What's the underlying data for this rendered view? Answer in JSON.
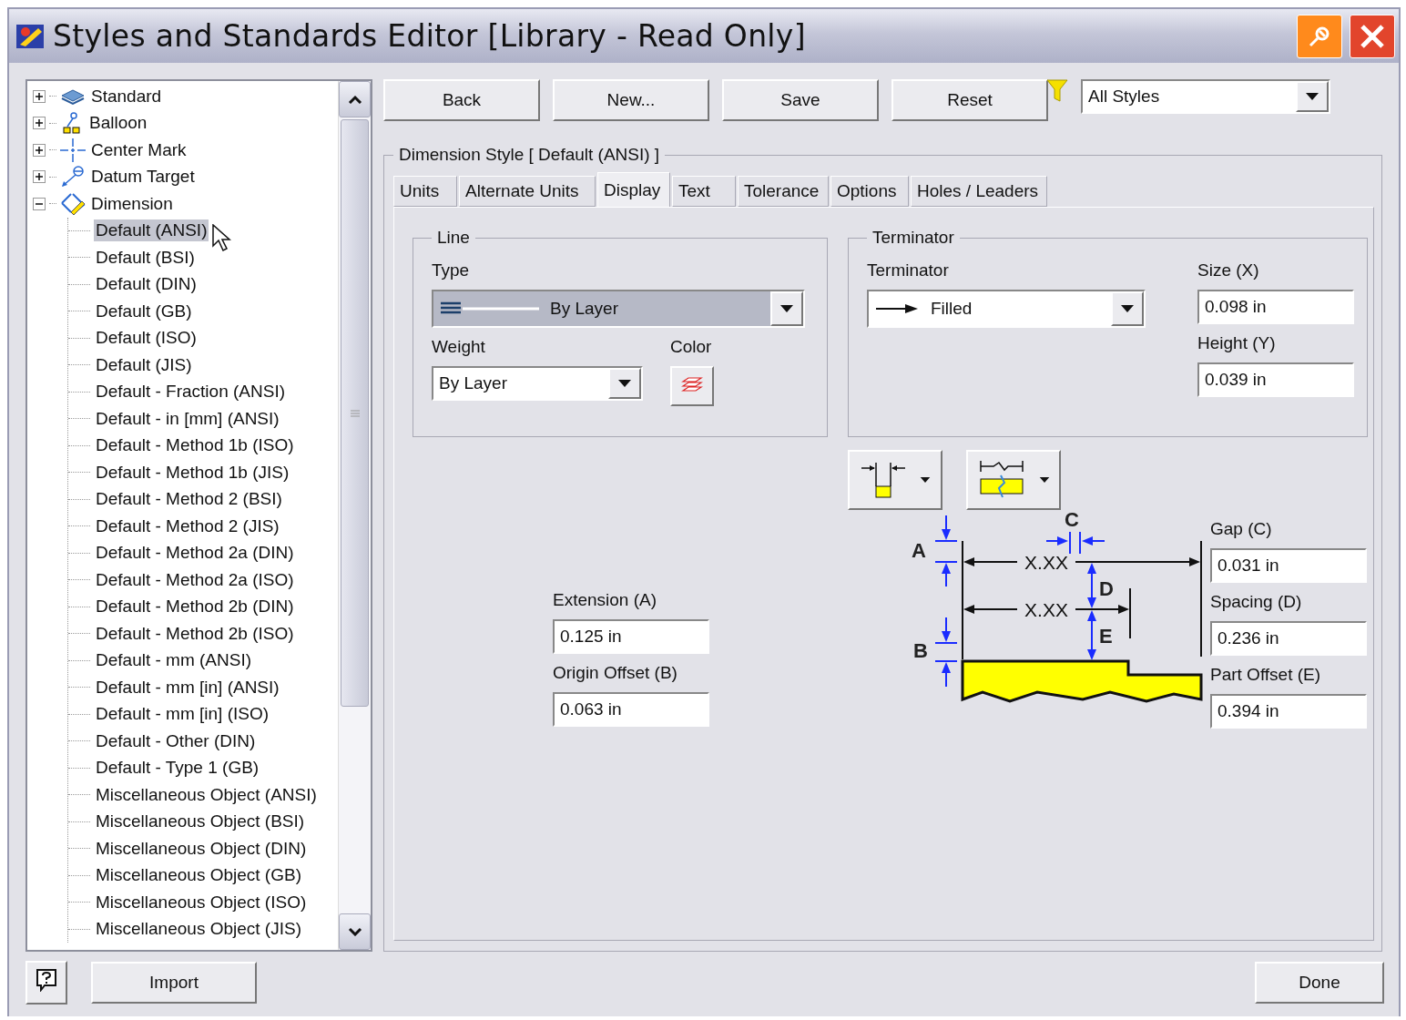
{
  "window": {
    "title": "Styles and Standards Editor [Library - Read Only]"
  },
  "tree": {
    "items": [
      {
        "label": "Standard",
        "expanded": false
      },
      {
        "label": "Balloon",
        "expanded": false
      },
      {
        "label": "Center Mark",
        "expanded": false
      },
      {
        "label": "Datum Target",
        "expanded": false
      },
      {
        "label": "Dimension",
        "expanded": true,
        "children": [
          {
            "label": "Default (ANSI)",
            "selected": true
          },
          {
            "label": "Default (BSI)",
            "selected": false
          },
          {
            "label": "Default (DIN)",
            "selected": false
          },
          {
            "label": "Default (GB)",
            "selected": false
          },
          {
            "label": "Default (ISO)",
            "selected": false
          },
          {
            "label": "Default (JIS)",
            "selected": false
          },
          {
            "label": "Default - Fraction (ANSI)",
            "selected": false
          },
          {
            "label": "Default - in [mm] (ANSI)",
            "selected": false
          },
          {
            "label": "Default - Method 1b (ISO)",
            "selected": false
          },
          {
            "label": "Default - Method 1b (JIS)",
            "selected": false
          },
          {
            "label": "Default - Method 2 (BSI)",
            "selected": false
          },
          {
            "label": "Default - Method 2 (JIS)",
            "selected": false
          },
          {
            "label": "Default - Method 2a (DIN)",
            "selected": false
          },
          {
            "label": "Default - Method 2a (ISO)",
            "selected": false
          },
          {
            "label": "Default - Method 2b (DIN)",
            "selected": false
          },
          {
            "label": "Default - Method 2b (ISO)",
            "selected": false
          },
          {
            "label": "Default - mm (ANSI)",
            "selected": false
          },
          {
            "label": "Default - mm [in] (ANSI)",
            "selected": false
          },
          {
            "label": "Default - mm [in] (ISO)",
            "selected": false
          },
          {
            "label": "Default - Other (DIN)",
            "selected": false
          },
          {
            "label": "Default - Type 1 (GB)",
            "selected": false
          },
          {
            "label": "Miscellaneous Object (ANSI)",
            "selected": false
          },
          {
            "label": "Miscellaneous Object (BSI)",
            "selected": false
          },
          {
            "label": "Miscellaneous Object (DIN)",
            "selected": false
          },
          {
            "label": "Miscellaneous Object (GB)",
            "selected": false
          },
          {
            "label": "Miscellaneous Object (ISO)",
            "selected": false
          },
          {
            "label": "Miscellaneous Object (JIS)",
            "selected": false
          }
        ]
      }
    ]
  },
  "toolbar": {
    "buttons": [
      "Back",
      "New...",
      "Save",
      "Reset"
    ],
    "filter": {
      "value": "All Styles"
    }
  },
  "style_group": {
    "title": "Dimension Style [ Default (ANSI) ]"
  },
  "tabs": [
    {
      "label": "Units",
      "selected": false
    },
    {
      "label": "Alternate Units",
      "selected": false
    },
    {
      "label": "Display",
      "selected": true
    },
    {
      "label": "Text",
      "selected": false
    },
    {
      "label": "Tolerance",
      "selected": false
    },
    {
      "label": "Options",
      "selected": false
    },
    {
      "label": "Holes / Leaders",
      "selected": false
    }
  ],
  "line": {
    "title": "Line",
    "type_label": "Type",
    "type_value": "By Layer",
    "weight_label": "Weight",
    "weight_value": "By Layer",
    "color_label": "Color"
  },
  "terminator": {
    "title": "Terminator",
    "terminator_label": "Terminator",
    "terminator_value": "Filled",
    "size_label": "Size (X)",
    "size_value": "0.098 in",
    "height_label": "Height (Y)",
    "height_value": "0.039 in"
  },
  "offsets_left": [
    {
      "label": "Extension (A)",
      "value": "0.125 in"
    },
    {
      "label": "Origin Offset (B)",
      "value": "0.063 in"
    }
  ],
  "offsets_right": [
    {
      "label": "Gap (C)",
      "value": "0.031 in"
    },
    {
      "label": "Spacing (D)",
      "value": "0.236 in"
    },
    {
      "label": "Part Offset (E)",
      "value": "0.394 in"
    }
  ],
  "diagram": {
    "letters": [
      "A",
      "B",
      "C",
      "D",
      "E"
    ],
    "dimension_texts": [
      "X.XX",
      "X.XX"
    ]
  },
  "footer": {
    "import": "Import",
    "done": "Done"
  }
}
